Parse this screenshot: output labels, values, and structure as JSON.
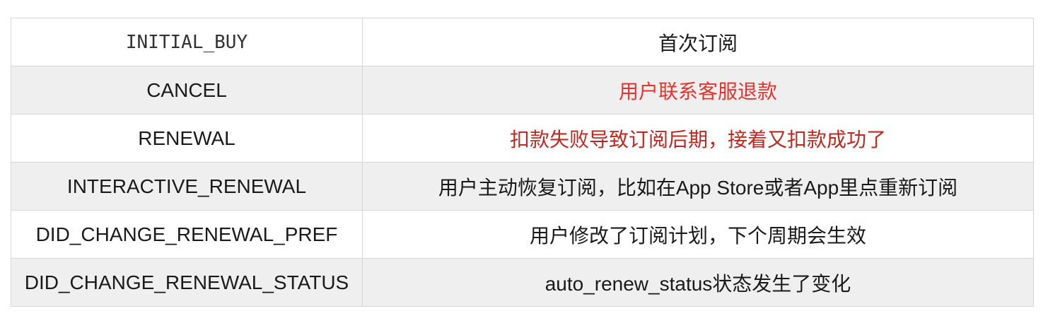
{
  "table": {
    "rows": [
      {
        "key": "INITIAL_BUY",
        "desc": "首次订阅",
        "desc_color": ""
      },
      {
        "key": "CANCEL",
        "desc": "用户联系客服退款",
        "desc_color": "#e8322d"
      },
      {
        "key": "RENEWAL",
        "desc": "扣款失败导致订阅后期，接着又扣款成功了",
        "desc_color": "#c0271f"
      },
      {
        "key": "INTERACTIVE_RENEWAL",
        "desc": "用户主动恢复订阅，比如在App Store或者App里点重新订阅",
        "desc_color": ""
      },
      {
        "key": "DID_CHANGE_RENEWAL_PREF",
        "desc": "用户修改了订阅计划，下个周期会生效",
        "desc_color": ""
      },
      {
        "key": "DID_CHANGE_RENEWAL_STATUS",
        "desc": "auto_renew_status状态发生了变化",
        "desc_color": ""
      }
    ]
  }
}
